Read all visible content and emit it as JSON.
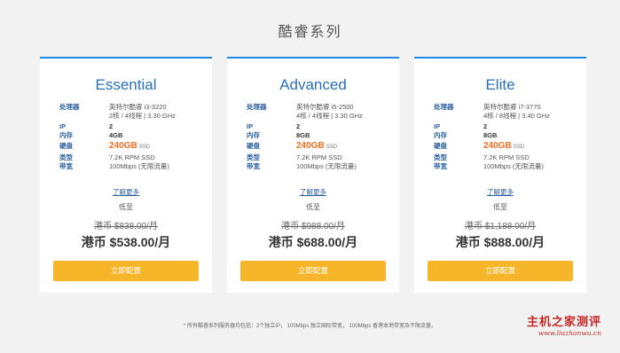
{
  "page": {
    "title": "酷睿系列"
  },
  "cards": [
    {
      "name": "Essential",
      "cpu_label": "处理器",
      "cpu": "英特尔酷睿 i3-3220",
      "cpu_sub": "2核 / 4线程 | 3.30 GHz",
      "ip_label": "IP",
      "ip": "2",
      "ram_label": "内存",
      "ram": "4GB",
      "disk_label": "硬盘",
      "disk": "240GB",
      "disk_unit": "SSD",
      "type_label": "类型",
      "type": "7.2K RPM SSD",
      "bw_label": "带宽",
      "bw": "100Mbps (无限流量)",
      "learn_more": "了解更多",
      "low": "低至",
      "old_price": "港币 $838.00/月",
      "new_price": "港币 $538.00/月",
      "cta": "立即配置"
    },
    {
      "name": "Advanced",
      "cpu_label": "处理器",
      "cpu": "英特尔酷睿 i5-2500",
      "cpu_sub": "4核 / 4线程 | 3.30 GHz",
      "ip_label": "IP",
      "ip": "2",
      "ram_label": "内存",
      "ram": "8GB",
      "disk_label": "硬盘",
      "disk": "240GB",
      "disk_unit": "SSD",
      "type_label": "类型",
      "type": "7.2K RPM SSD",
      "bw_label": "带宽",
      "bw": "100Mbps (无限流量)",
      "learn_more": "了解更多",
      "low": "低至",
      "old_price": "港币 $988.00/月",
      "new_price": "港币 $688.00/月",
      "cta": "立即配置"
    },
    {
      "name": "Elite",
      "cpu_label": "处理器",
      "cpu": "英特尔酷睿 i7-3770",
      "cpu_sub": "4核 / 8线程 | 3.40 GHz",
      "ip_label": "IP",
      "ip": "2",
      "ram_label": "内存",
      "ram": "8GB",
      "disk_label": "硬盘",
      "disk": "240GB",
      "disk_unit": "SSD",
      "type_label": "类型",
      "type": "7.2K RPM SSD",
      "bw_label": "带宽",
      "bw": "100Mbps (无限流量)",
      "learn_more": "了解更多",
      "low": "低至",
      "old_price": "港币 $1,188.00/月",
      "new_price": "港币 $888.00/月",
      "cta": "立即配置"
    }
  ],
  "footnote": "* 所有酷睿系列服务器均包括：2个独立IP， 100Mbps 独立国际带宽， 100Mbps 香港本地带宽及不限流量。",
  "watermark": {
    "title": "主机之家测评",
    "url": "www.liuzhanwu.cn"
  },
  "colors": {
    "accent": "#1e88e5",
    "cta": "#f7b52a",
    "highlight": "#f26d21"
  }
}
